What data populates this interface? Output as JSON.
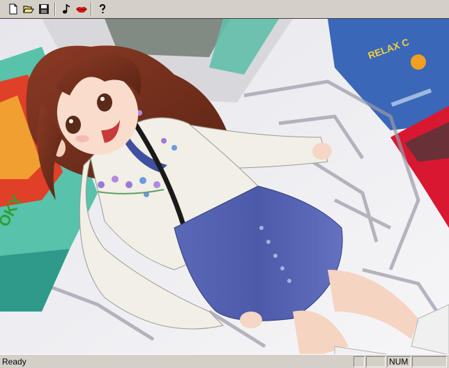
{
  "toolbar": {
    "buttons": [
      {
        "id": "new",
        "icon": "new-document-icon"
      },
      {
        "id": "open",
        "icon": "open-folder-icon"
      },
      {
        "id": "save",
        "icon": "floppy-disk-icon"
      },
      {
        "id": "music",
        "icon": "music-note-icon"
      },
      {
        "id": "voice",
        "icon": "lips-icon"
      },
      {
        "id": "help",
        "icon": "help-question-icon"
      }
    ]
  },
  "canvas": {
    "sign_text": "RELAX C",
    "shop_text": "OKY"
  },
  "statusbar": {
    "text": "Ready",
    "panes": [
      "",
      "",
      "NUM",
      ""
    ]
  },
  "colors": {
    "chrome": "#d4d0c8",
    "skirt": "#4f5fb0",
    "sweater": "#f1efe6",
    "hair": "#7a3220",
    "sign_red": "#d81830",
    "sign_blue": "#3a67b8",
    "teal": "#58c2ab"
  }
}
